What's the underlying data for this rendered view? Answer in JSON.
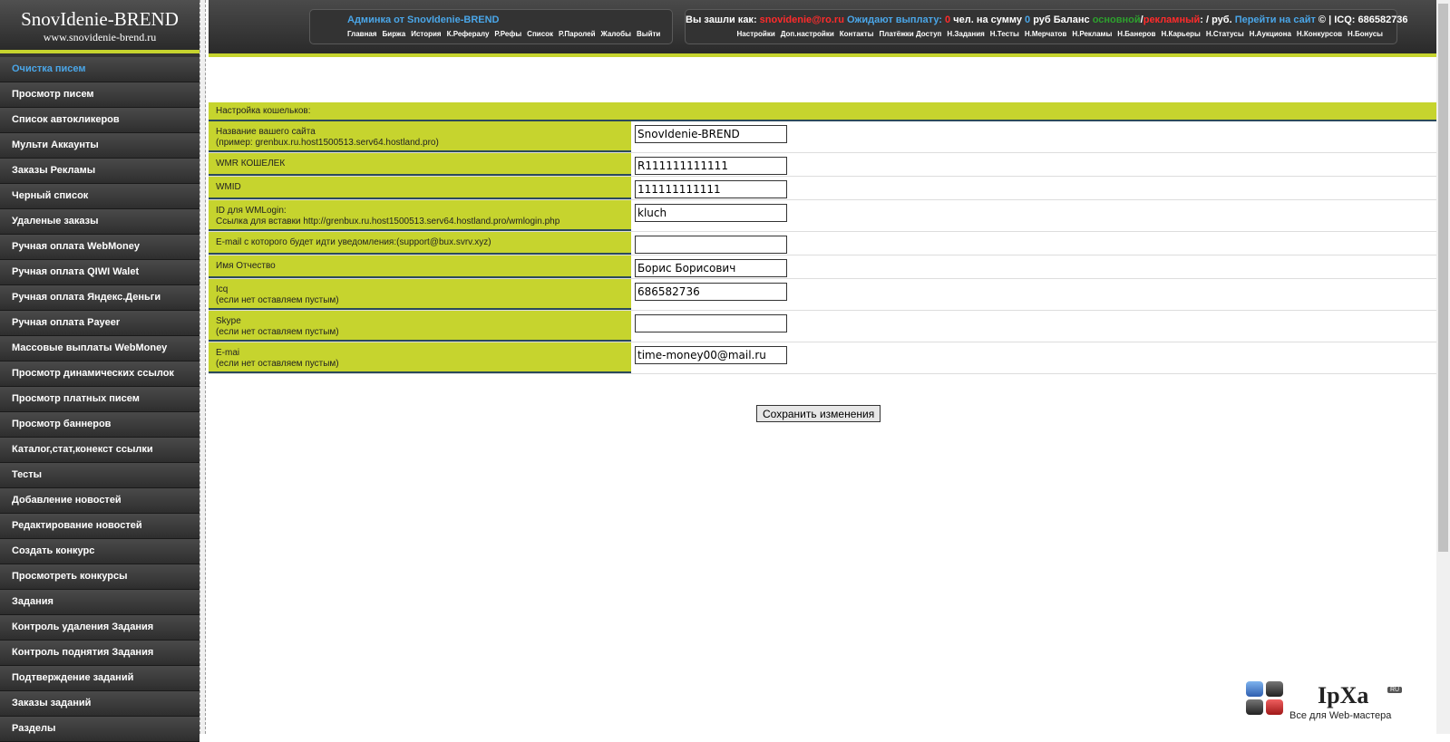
{
  "logo": {
    "title": "SnovIdenie-BREND",
    "url": "www.snovidenie-brend.ru"
  },
  "sidebar": {
    "items": [
      "Очистка писем",
      "Просмотр писем",
      "Список автокликеров",
      "Мульти Аккаунты",
      "Заказы Рекламы",
      "Черный список",
      "Удаленые заказы",
      "Ручная оплата WebMoney",
      "Ручная оплата QIWI Walet",
      "Ручная оплата Яндекс.Деньги",
      "Ручная оплата Payeer",
      "Массовые выплаты WebMoney",
      "Просмотр динамических ссылок",
      "Просмотр платных писем",
      "Просмотр баннеров",
      "Каталог,стат,конекст ссылки",
      "Тесты",
      "Добавление новостей",
      "Редактирование новостей",
      "Создать конкурс",
      "Просмотреть конкурсы",
      "Задания",
      "Контроль удаления Задания",
      "Контроль поднятия Задания",
      "Подтверждение заданий",
      "Заказы заданий",
      "Разделы"
    ]
  },
  "header": {
    "admin_prefix": "Админка от ",
    "admin_name": "SnovIdenie-BREND",
    "links_left": [
      "Главная",
      "Биржа",
      "История",
      "К.Рефералу",
      "Р.Рефы",
      "Список",
      "Р.Паролей",
      "Жалобы",
      "Выйти"
    ],
    "status": {
      "logged_as": "Вы зашли как: ",
      "email": "snovidenie@ro.ru",
      "awaiting": " Ожидают выплату: ",
      "count": "0",
      "people": " чел. на сумму ",
      "sum": "0",
      "rub_balance": " руб Баланс ",
      "main": "основной",
      "slash": "/",
      "ads": "рекламный",
      "rub": ": / руб. ",
      "goto_site": "Перейти на сайт",
      "icq": " © | ICQ: 686582736"
    },
    "links_right": [
      "Настройки",
      "Доп.настройки",
      "Контакты",
      "Платёжки Доступ",
      "Н.Задания",
      "Н.Тесты",
      "Н.Мерчатов",
      "Н.Рекламы",
      "Н.Банеров",
      "Н.Карьеры",
      "Н.Статусы",
      "Н.Аукциона",
      "Н.Конкурсов",
      "Н.Бонусы"
    ]
  },
  "settings": {
    "heading": "Настройка кошельков:",
    "rows": [
      {
        "label1": "Название вашего сайта",
        "label2": "(пример: grenbux.ru.host1500513.serv64.hostland.pro)",
        "value": "SnovIdenie-BREND"
      },
      {
        "label1": "WMR КОШЕЛЕК",
        "label2": "",
        "value": "R111111111111"
      },
      {
        "label1": "WMID",
        "label2": "",
        "value": "111111111111"
      },
      {
        "label1": "ID для WMLogin:",
        "label2": "Ссылка для вставки http://grenbux.ru.host1500513.serv64.hostland.pro/wmlogin.php",
        "value": "kluch"
      },
      {
        "label1": "E-mail с которого будет идти уведомления:(support@bux.svrv.xyz)",
        "label2": "",
        "value": ""
      },
      {
        "label1": "Имя Отчество",
        "label2": "",
        "value": "Борис Борисович"
      },
      {
        "label1": "Icq",
        "label2": "(если нет оставляем пустым)",
        "value": "686582736"
      },
      {
        "label1": "Skype",
        "label2": "(если нет оставляем пустым)",
        "value": ""
      },
      {
        "label1": "E-mai",
        "label2": "(если нет оставляем пустым)",
        "value": "time-money00@mail.ru"
      }
    ],
    "save_label": "Сохранить изменения"
  },
  "watermark": {
    "brand": "IpXa",
    "tld": "RU",
    "tagline": "Все для Web-мастера"
  },
  "colors": {
    "accent": "#c6d42e",
    "link_blue": "#4aa6e8",
    "red": "#ff2b2b",
    "green": "#2ea02e",
    "dark": "#333333"
  }
}
